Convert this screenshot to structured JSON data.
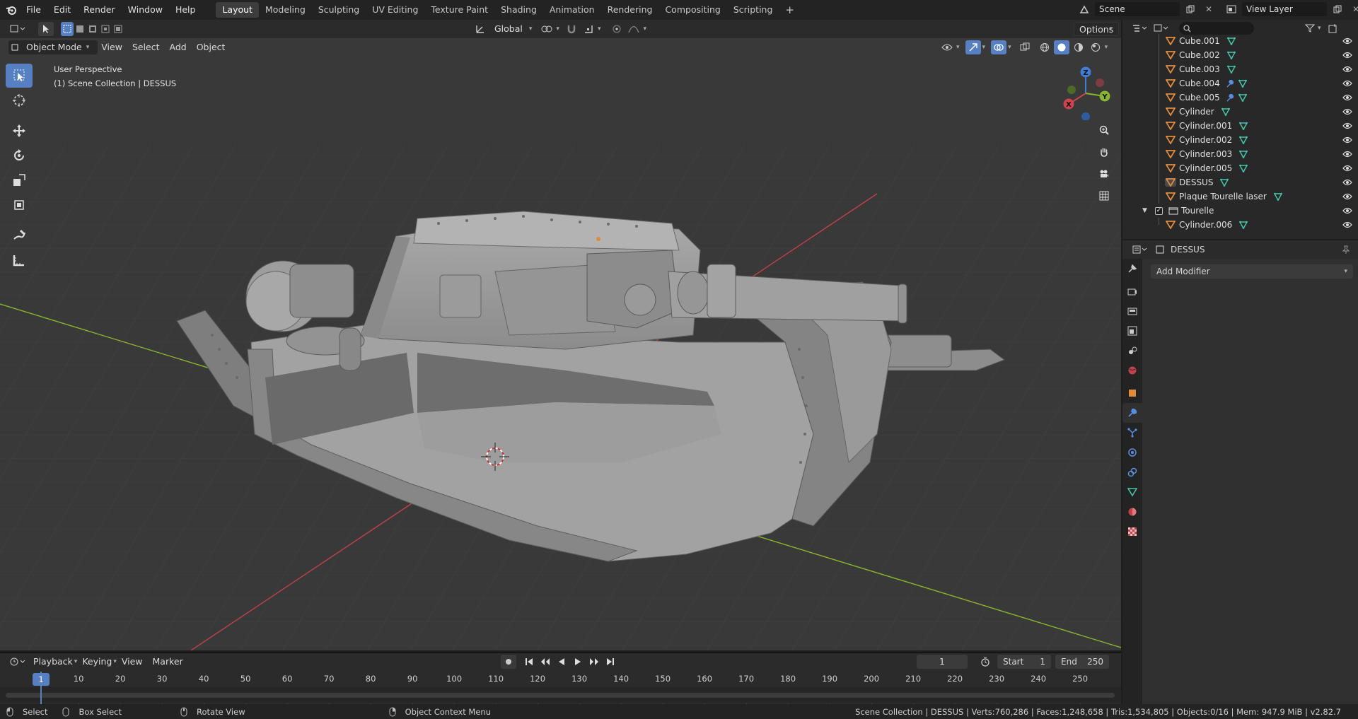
{
  "topbar": {
    "menus": [
      "File",
      "Edit",
      "Render",
      "Window",
      "Help"
    ],
    "workspaces": [
      "Layout",
      "Modeling",
      "Sculpting",
      "UV Editing",
      "Texture Paint",
      "Shading",
      "Animation",
      "Rendering",
      "Compositing",
      "Scripting"
    ],
    "active_workspace": "Layout",
    "add_tab": "+",
    "scene_name": "Scene",
    "view_layer": "View Layer"
  },
  "viewport_header": {
    "mode": "Object Mode",
    "menus": [
      "View",
      "Select",
      "Add",
      "Object"
    ],
    "orientation": "Global",
    "options": "Options"
  },
  "viewport": {
    "view_name": "User Perspective",
    "collection_info": "(1) Scene Collection | DESSUS",
    "gizmo": {
      "z": "Z",
      "y": "Y",
      "x": "X"
    }
  },
  "outliner": {
    "search_placeholder": "",
    "rows": [
      {
        "name": "Cube.001",
        "modifier": false
      },
      {
        "name": "Cube.002",
        "modifier": false
      },
      {
        "name": "Cube.003",
        "modifier": false
      },
      {
        "name": "Cube.004",
        "modifier": true
      },
      {
        "name": "Cube.005",
        "modifier": true
      },
      {
        "name": "Cylinder",
        "modifier": false
      },
      {
        "name": "Cylinder.001",
        "modifier": false
      },
      {
        "name": "Cylinder.002",
        "modifier": false
      },
      {
        "name": "Cylinder.003",
        "modifier": false
      },
      {
        "name": "Cylinder.005",
        "modifier": false
      },
      {
        "name": "DESSUS",
        "modifier": false
      },
      {
        "name": "Plaque Tourelle laser",
        "modifier": false
      }
    ],
    "collection": "Tourelle",
    "child": "Cylinder.006"
  },
  "properties": {
    "object_name": "DESSUS",
    "add_modifier": "Add Modifier"
  },
  "timeline": {
    "menus": [
      "Playback",
      "Keying",
      "View",
      "Marker"
    ],
    "current_frame": "1",
    "start_label": "Start",
    "start_value": "1",
    "end_label": "End",
    "end_value": "250",
    "ticks": [
      "1",
      "10",
      "20",
      "30",
      "40",
      "50",
      "60",
      "70",
      "80",
      "90",
      "100",
      "110",
      "120",
      "130",
      "140",
      "150",
      "160",
      "170",
      "180",
      "190",
      "200",
      "210",
      "220",
      "230",
      "240",
      "250"
    ]
  },
  "statusbar": {
    "select": "Select",
    "box_select": "Box Select",
    "rotate_view": "Rotate View",
    "context_menu": "Object Context Menu",
    "stats": "Scene Collection | DESSUS | Verts:760,286 | Faces:1,248,658 | Tris:1,534,805 | Objects:0/16 | Mem: 947.9 MiB | v2.82.7"
  },
  "colors": {
    "accent": "#5680c2",
    "mesh_icon": "#e08a3c",
    "data_icon": "#47c2a8",
    "x_axis": "#d0434f",
    "y_axis": "#8ab52e",
    "z_axis": "#3e7ed6"
  }
}
